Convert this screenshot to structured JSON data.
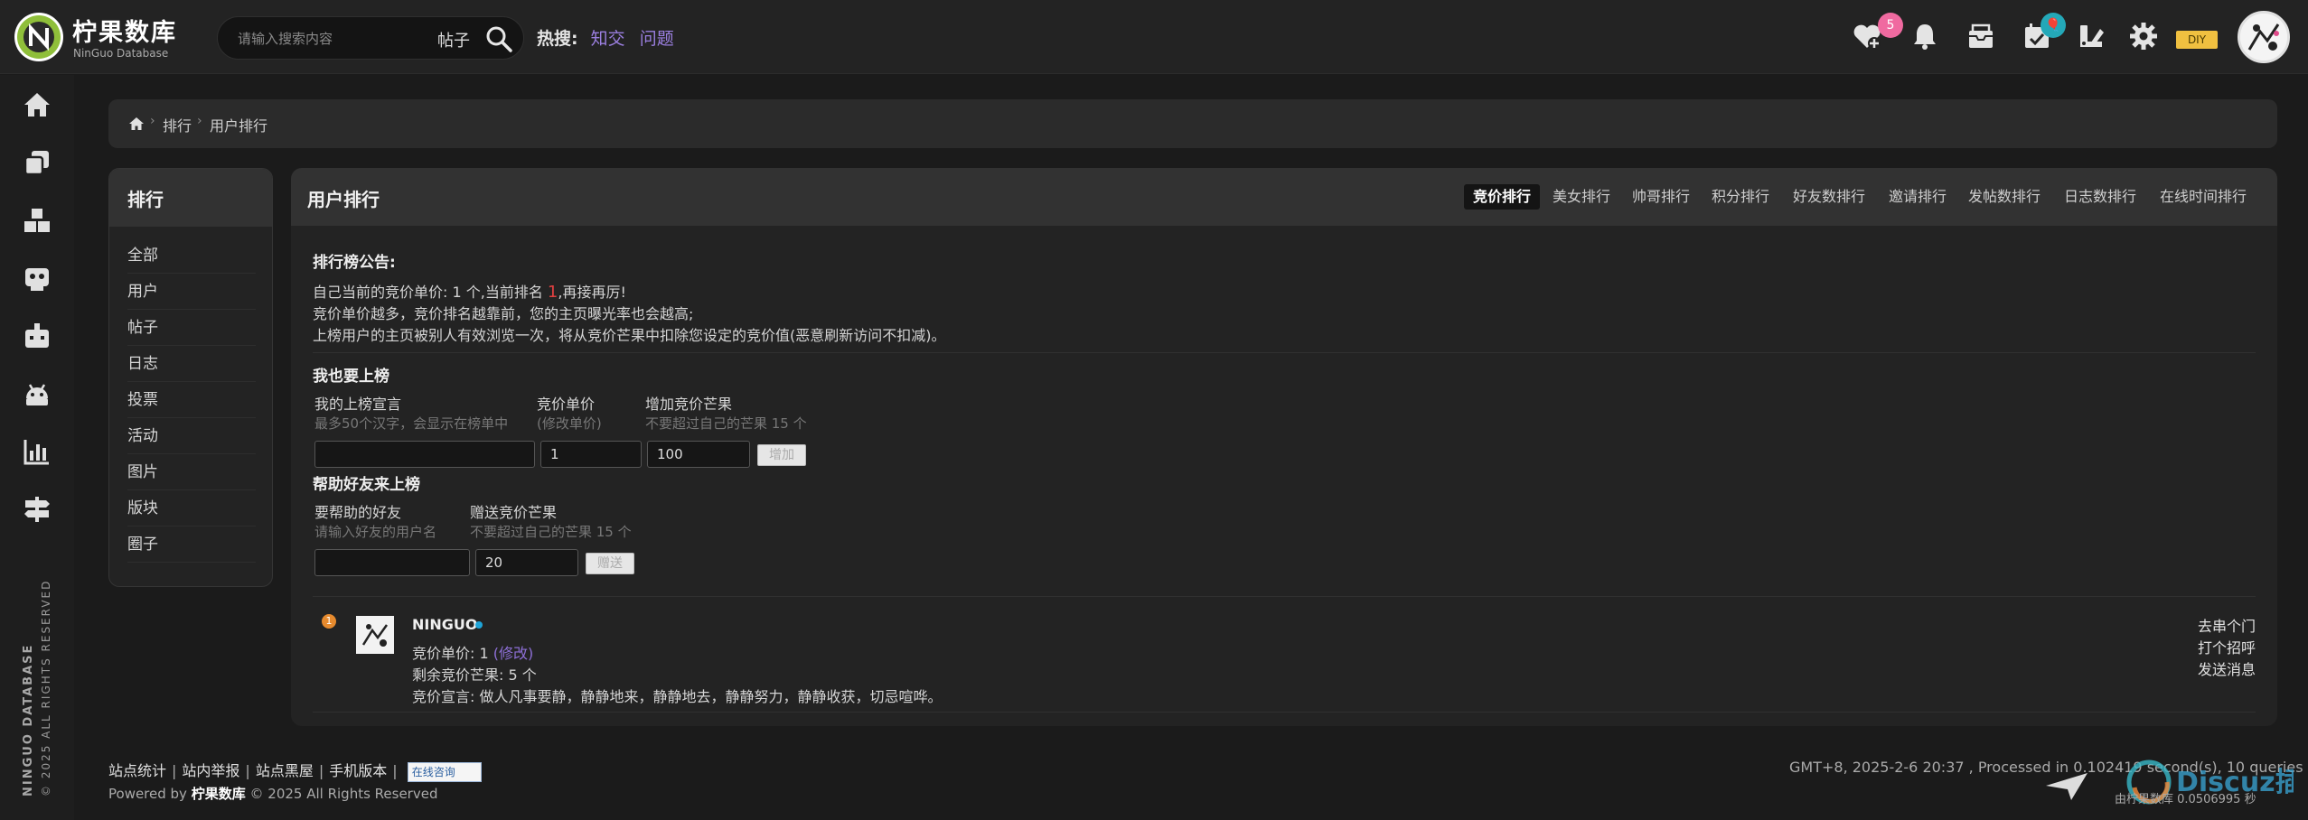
{
  "brand": {
    "name": "柠果数库",
    "subtitle": "NinGuo Database"
  },
  "search": {
    "placeholder": "请输入搜索内容",
    "type": "帖子"
  },
  "hot": {
    "label": "热搜:",
    "links": [
      "知交",
      "问题"
    ]
  },
  "topbar": {
    "icons": [
      "heart-add-icon",
      "bell-icon",
      "mailbox-icon",
      "calendar-check-icon",
      "brush-icon",
      "gear-icon"
    ],
    "heart_badge": "5",
    "calendar_badge": "🎈",
    "diy": "DIY"
  },
  "sidebar": {
    "icons": [
      "home-icon",
      "copy-icon",
      "boxes-icon",
      "robot-face-icon",
      "game-icon",
      "android-icon",
      "bar-chart-icon",
      "signpost-icon"
    ],
    "vertical_brand": "NINGUO DATABASE",
    "vertical_copy": "© 2025 ALL RIGHTS RESERVED",
    "vertical_cn": "柠果数库"
  },
  "breadcrumb": {
    "items": [
      "排行",
      "用户排行"
    ]
  },
  "left_panel": {
    "title": "排行",
    "items": [
      "全部",
      "用户",
      "帖子",
      "日志",
      "投票",
      "活动",
      "图片",
      "版块",
      "圈子"
    ]
  },
  "main": {
    "title": "用户排行",
    "tabs": [
      "竞价排行",
      "美女排行",
      "帅哥排行",
      "积分排行",
      "好友数排行",
      "邀请排行",
      "发帖数排行",
      "日志数排行",
      "在线时间排行"
    ],
    "active_tab": "竞价排行",
    "notice": {
      "title": "排行榜公告:",
      "line1_a": "自己当前的竞价单价: 1 个,当前排名 ",
      "line1_rank": "1",
      "line1_b": ",再接再厉!",
      "line2": "竞价单价越多，竞价排名越靠前，您的主页曝光率也会越高;",
      "line3": "上榜用户的主页被别人有效浏览一次，将从竞价芒果中扣除您设定的竞价值(恶意刷新访问不扣减)。"
    },
    "join": {
      "title": "我也要上榜",
      "declare_label": "我的上榜宣言",
      "declare_hint": "最多50个汉字，会显示在榜单中",
      "price_label": "竞价单价",
      "price_hint": "(修改单价)",
      "price_value": "1",
      "add_label": "增加竞价芒果",
      "add_hint": "不要超过自己的芒果 15 个",
      "add_value": "100",
      "add_button": "增加"
    },
    "help": {
      "title": "帮助好友来上榜",
      "friend_label": "要帮助的好友",
      "friend_hint": "请输入好友的用户名",
      "gift_label": "赠送竞价芒果",
      "gift_hint": "不要超过自己的芒果 15 个",
      "gift_value": "20",
      "gift_button": "赠送"
    },
    "ranking": [
      {
        "rank": "1",
        "name": "NINGUO",
        "price_label": "竞价单价: 1",
        "price_edit": "(修改)",
        "remaining": "剩余竞价芒果: 5 个",
        "declaration": "竞价宣言: 做人凡事要静，静静地来，静静地去，静静努力，静静收获，切忌喧哗。",
        "actions": [
          "去串个门",
          "打个招呼",
          "发送消息"
        ]
      }
    ]
  },
  "footer": {
    "links": [
      "站点统计",
      "站内举报",
      "站点黑屋",
      "手机版本"
    ],
    "qq": "在线咨询",
    "powered_prefix": "Powered by ",
    "powered_brand": "柠果数库",
    "powered_suffix": " © 2025 All Rights Reserved",
    "gmt": "GMT+8, 2025-2-6 20:37 , Processed in 0.102419 second(s), 10 queries .",
    "watermark": "Discuz插件网",
    "watermark_sub": "由柠果数库 0.0506995 秒"
  },
  "colors": {
    "accent_purple": "#9b7fe0",
    "rank_orange": "#e68a2e",
    "online_blue": "#1ea4d8",
    "badge_pink": "#f06aa0",
    "badge_teal": "#24a8b8"
  }
}
